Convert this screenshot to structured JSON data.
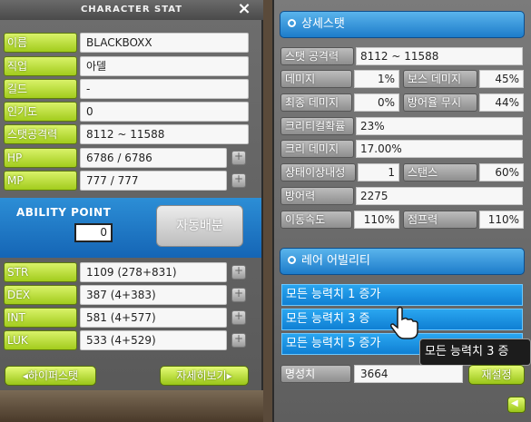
{
  "window": {
    "title": "CHARACTER STAT",
    "close_label": "×"
  },
  "character": {
    "rows": [
      {
        "label": "이름",
        "value": "BLACKBOXX"
      },
      {
        "label": "직업",
        "value": "아델"
      },
      {
        "label": "길드",
        "value": "-"
      },
      {
        "label": "인기도",
        "value": "0"
      },
      {
        "label": "스탯공격력",
        "value": "8112 ~ 11588"
      },
      {
        "label": "HP",
        "value": "6786 / 6786"
      },
      {
        "label": "MP",
        "value": "777 / 777"
      }
    ]
  },
  "ability": {
    "title": "ABILITY POINT",
    "points": "0",
    "auto_distribute": "자동배분"
  },
  "stats": [
    {
      "label": "STR",
      "value": "1109 (278+831)"
    },
    {
      "label": "DEX",
      "value": "387 (4+383)"
    },
    {
      "label": "INT",
      "value": "581 (4+577)"
    },
    {
      "label": "LUK",
      "value": "533 (4+529)"
    }
  ],
  "buttons": {
    "hyper_stat": "◂하이퍼스탯",
    "detail_view": "자세히보기▸"
  },
  "detail": {
    "title": "상세스탯",
    "stat_attack": {
      "label": "스탯 공격력",
      "value": "8112 ~ 11588"
    },
    "pairs": [
      [
        {
          "label": "데미지",
          "value": "1%"
        },
        {
          "label": "보스 데미지",
          "value": "45%"
        }
      ],
      [
        {
          "label": "최종 데미지",
          "value": "0%"
        },
        {
          "label": "방어율 무시",
          "value": "44%"
        }
      ]
    ],
    "crit_rate": {
      "label": "크리티컬확률",
      "value": "23%"
    },
    "crit_damage": {
      "label": "크리 데미지",
      "value": "17.00%"
    },
    "status_resist": {
      "label": "상태이상내성",
      "value": "1"
    },
    "stance": {
      "label": "스탠스",
      "value": "60%"
    },
    "defense": {
      "label": "방어력",
      "value": "2275"
    },
    "speed": {
      "label": "이동속도",
      "value": "110%"
    },
    "jump": {
      "label": "점프력",
      "value": "110%"
    }
  },
  "rare": {
    "title": "레어 어빌리티",
    "items": [
      "모든 능력치 1 증가",
      "모든 능력치 3 증",
      "모든 능력치 5 증가"
    ],
    "tooltip": "모든 능력치 3 증"
  },
  "fame": {
    "label": "명성치",
    "value": "3664",
    "reset_label": "재설정"
  }
}
